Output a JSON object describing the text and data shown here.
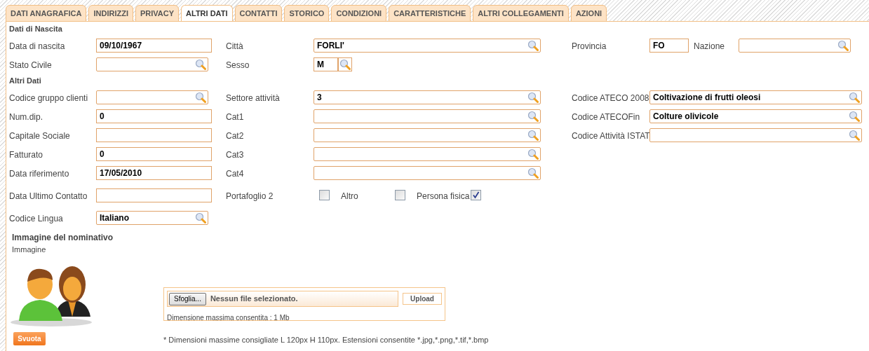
{
  "tabs": [
    {
      "label": "DATI ANAGRAFICA",
      "selected": false
    },
    {
      "label": "INDIRIZZI",
      "selected": false
    },
    {
      "label": "PRIVACY",
      "selected": false
    },
    {
      "label": "ALTRI DATI",
      "selected": true
    },
    {
      "label": "CONTATTI",
      "selected": false
    },
    {
      "label": "STORICO",
      "selected": false
    },
    {
      "label": "CONDIZIONI",
      "selected": false
    },
    {
      "label": "CARATTERISTICHE",
      "selected": false
    },
    {
      "label": "ALTRI COLLEGAMENTI",
      "selected": false
    },
    {
      "label": "AZIONI",
      "selected": false
    }
  ],
  "sections": [
    {
      "title": "Dati di Nascita",
      "rows": [
        {
          "cells": [
            {
              "label": "Data di nascita",
              "kind": "text",
              "value": "09/10/1967"
            },
            {
              "label": "Città",
              "kind": "lookup",
              "value": "FORLI'"
            },
            {
              "label": "Provincia",
              "kind": "short",
              "value": "FO",
              "extra": {
                "label": "Nazione",
                "kind": "lookup"
              }
            }
          ]
        },
        {
          "cells": [
            {
              "label": "Stato Civile",
              "kind": "lookup"
            },
            {
              "label": "Sesso",
              "kind": "short_lookup",
              "value": "M"
            }
          ]
        }
      ]
    },
    {
      "title": "Altri Dati",
      "rows": [
        {
          "cells": [
            {
              "label": "Codice gruppo clienti",
              "kind": "lookup"
            },
            {
              "label": "Settore attività",
              "kind": "lookup",
              "value": "3"
            },
            {
              "label": "Codice ATECO 2008",
              "kind": "lookup",
              "value": "Coltivazione di frutti oleosi"
            }
          ]
        },
        {
          "cells": [
            {
              "label": "Num.dip.",
              "kind": "text",
              "value": "0"
            },
            {
              "label": "Cat1",
              "kind": "lookup"
            },
            {
              "label": "Codice ATECOFin",
              "kind": "lookup",
              "value": "Colture olivicole"
            }
          ]
        },
        {
          "cells": [
            {
              "label": "Capitale Sociale",
              "kind": "text"
            },
            {
              "label": "Cat2",
              "kind": "lookup"
            },
            {
              "label": "Codice Attività ISTAT",
              "kind": "lookup"
            }
          ]
        },
        {
          "cells": [
            {
              "label": "Fatturato",
              "kind": "text",
              "value": "0"
            },
            {
              "label": "Cat3",
              "kind": "lookup"
            }
          ]
        },
        {
          "cells": [
            {
              "label": "Data riferimento",
              "kind": "text",
              "value": "17/05/2010"
            },
            {
              "label": "Cat4",
              "kind": "lookup"
            }
          ]
        },
        {
          "cells": [
            {
              "label": "Data Ultimo Contatto",
              "kind": "text"
            },
            {
              "kind": "checkboxes",
              "items": [
                {
                  "label": "Portafoglio 2",
                  "checked": false
                },
                {
                  "label": "Altro",
                  "checked": false
                },
                {
                  "label": "Persona fisica",
                  "checked": true
                }
              ]
            }
          ]
        },
        {
          "cells": [
            {
              "label": "Codice Lingua",
              "kind": "lookup",
              "value": "Italiano"
            }
          ]
        }
      ]
    }
  ],
  "image_section": {
    "title": "Immagine del nominativo",
    "label": "Immagine",
    "browse_button": "Sfoglia...",
    "file_status": "Nessun file selezionato.",
    "upload_button": "Upload",
    "max_size": "Dimensione massima consentita : 1 Mb",
    "clear_button": "Svuota",
    "note": "* Dimensioni massime consigliate L 120px H 110px. Estensioni consentite *.jpg,*.png,*.tif,*.bmp"
  }
}
